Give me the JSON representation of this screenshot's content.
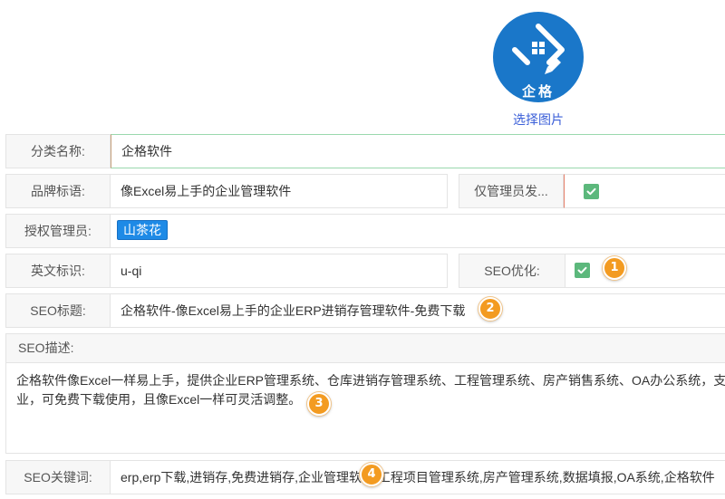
{
  "logo": {
    "text": "企格",
    "select_image_label": "选择图片",
    "icon": "window-diamond-pen-icon"
  },
  "form": {
    "category_name": {
      "label": "分类名称:",
      "value": "企格软件"
    },
    "brand_slogan": {
      "label": "品牌标语:",
      "value": "像Excel易上手的企业管理软件"
    },
    "admin_only_publish": {
      "label": "仅管理员发...",
      "checked": true
    },
    "authorized_admins": {
      "label": "授权管理员:",
      "tags": [
        "山茶花"
      ]
    },
    "english_id": {
      "label": "英文标识:",
      "value": "u-qi"
    },
    "seo_optimize": {
      "label": "SEO优化:",
      "checked": true
    },
    "seo_title": {
      "label": "SEO标题:",
      "value": "企格软件-像Excel易上手的企业ERP进销存管理软件-免费下载"
    },
    "seo_description": {
      "label": "SEO描述:",
      "lines": [
        "企格软件像Excel一样易上手，提供企业ERP管理系统、仓库进销存管理系统、工程管理系统、房产销售系统、OA办公系统，支持",
        "业，可免费下载使用，且像Excel一样可灵活调整。"
      ]
    },
    "seo_keywords": {
      "label": "SEO关键词:",
      "value": "erp,erp下载,进销存,免费进销存,企业管理软件,工程项目管理系统,房产管理系统,数据填报,OA系统,企格软件"
    }
  },
  "annotations": [
    "1",
    "2",
    "3",
    "4"
  ],
  "colors": {
    "brand_blue": "#1a77c9",
    "link_blue": "#3b5fd8",
    "check_green": "#5cb87c",
    "focus_green": "#9ad8ae",
    "tag_blue": "#1e8ae6",
    "badge_orange": "#f39b21"
  }
}
